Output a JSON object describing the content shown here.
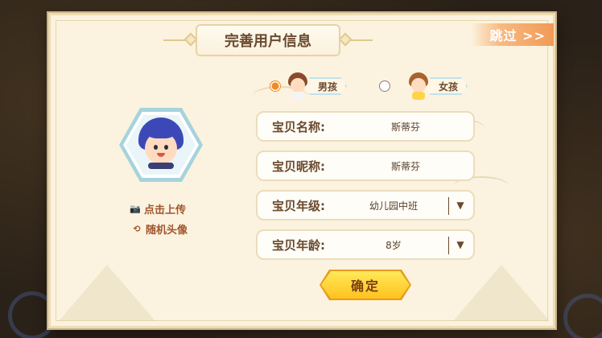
{
  "dialog": {
    "title": "完善用户信息",
    "skip_label": "跳过 >>"
  },
  "avatar": {
    "upload_label": "点击上传",
    "random_label": "随机头像"
  },
  "gender": {
    "options": [
      {
        "label": "男孩",
        "selected": true
      },
      {
        "label": "女孩",
        "selected": false
      }
    ]
  },
  "form": {
    "name": {
      "label": "宝贝名称:",
      "value": "斯蒂芬"
    },
    "nickname": {
      "label": "宝贝昵称:",
      "value": "斯蒂芬"
    },
    "grade": {
      "label": "宝贝年级:",
      "value": "幼儿园中班"
    },
    "age": {
      "label": "宝贝年龄:",
      "value": "8岁"
    }
  },
  "confirm_label": "确定",
  "colors": {
    "panel": "#fbf3df",
    "accent_orange": "#f08a22",
    "confirm_yellow": "#ffc21e",
    "text_brown": "#6a4a2f"
  },
  "icons": [
    "camera-icon",
    "refresh-icon",
    "dropdown-arrow-icon"
  ]
}
